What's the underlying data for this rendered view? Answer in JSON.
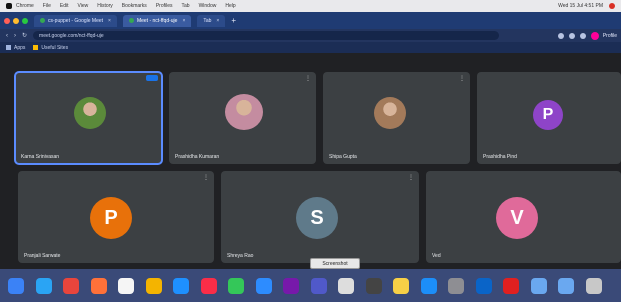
{
  "menubar": {
    "items": [
      "Chrome",
      "File",
      "Edit",
      "View",
      "History",
      "Bookmarks",
      "Profiles",
      "Tab",
      "Window",
      "Help"
    ],
    "status": "Wed 15 Jul 4:51 PM"
  },
  "browser": {
    "tabs": [
      {
        "label": "cs-puppet - Google Meet"
      },
      {
        "label": "Meet - nct-ffqd-uje"
      },
      {
        "label": "Tab"
      }
    ],
    "url": "meet.google.com/nct-ffqd-uje",
    "profile_label": "Profile",
    "bookmarks": [
      {
        "label": "Apps"
      },
      {
        "label": "Useful Sites"
      }
    ]
  },
  "meet": {
    "tiles": [
      {
        "name": "Karna Srinivasan",
        "kind": "photo",
        "color": "#5b8a3a"
      },
      {
        "name": "Prashidha Kumaran",
        "kind": "photo",
        "color": "#c48ca0"
      },
      {
        "name": "Shipa Gupta",
        "kind": "photo",
        "color": "#a37a5a"
      },
      {
        "name": "Prashidha Pind",
        "kind": "letter",
        "letter": "P",
        "color": "#8e44c8"
      },
      {
        "name": "Pranjali Sarwate",
        "kind": "letter",
        "letter": "P",
        "color": "#e8710a"
      },
      {
        "name": "Shreya Rao",
        "kind": "letter",
        "letter": "S",
        "color": "#5f7a8a"
      },
      {
        "name": "Ved",
        "kind": "letter",
        "letter": "V",
        "color": "#e06a9a"
      }
    ]
  },
  "dock": {
    "tooltip": "Screenshot",
    "apps": [
      {
        "icon": "finder-icon",
        "color": "#3b82f6"
      },
      {
        "icon": "safari-icon",
        "color": "#2aa4f4"
      },
      {
        "icon": "chrome-icon",
        "color": "#e8453c"
      },
      {
        "icon": "firefox-icon",
        "color": "#ff7139"
      },
      {
        "icon": "calendar-icon",
        "color": "#f5f5f5"
      },
      {
        "icon": "photos-icon",
        "color": "#f4b400"
      },
      {
        "icon": "mail-icon",
        "color": "#1e90ff"
      },
      {
        "icon": "music-icon",
        "color": "#fa2d48"
      },
      {
        "icon": "messages-icon",
        "color": "#34c759"
      },
      {
        "icon": "zoom-icon",
        "color": "#2d8cff"
      },
      {
        "icon": "onenote-icon",
        "color": "#7719aa"
      },
      {
        "icon": "teams-icon",
        "color": "#5059c9"
      },
      {
        "icon": "preview-icon",
        "color": "#dddddd"
      },
      {
        "icon": "screenshot-icon",
        "color": "#444444"
      },
      {
        "icon": "notes-icon",
        "color": "#f7d046"
      },
      {
        "icon": "appstore-icon",
        "color": "#1c8ef9"
      },
      {
        "icon": "settings-icon",
        "color": "#8e8e93"
      },
      {
        "icon": "outlook-icon",
        "color": "#0a64c8"
      },
      {
        "icon": "pdf-icon",
        "color": "#e02020"
      },
      {
        "icon": "folder-icon",
        "color": "#6aa8f0"
      },
      {
        "icon": "downloads-icon",
        "color": "#6aa8f0"
      },
      {
        "icon": "trash-icon",
        "color": "#c8c8c8"
      }
    ]
  }
}
